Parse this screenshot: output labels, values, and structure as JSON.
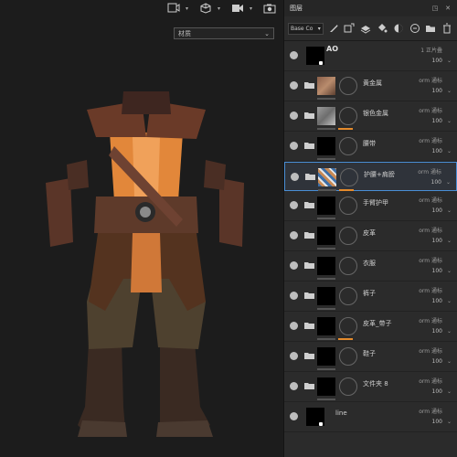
{
  "panel": {
    "title": "图层",
    "channel_select": "Base Co",
    "layers": [
      {
        "name": "AO",
        "blend": "1 正片叠",
        "opacity": "100",
        "type": "fill"
      },
      {
        "name": "黄金属",
        "blend": "orm 通标",
        "opacity": "100",
        "type": "folder",
        "thumb": "color1"
      },
      {
        "name": "银色金属",
        "blend": "orm 通标",
        "opacity": "100",
        "type": "folder",
        "thumb": "color2",
        "mask_bar": true
      },
      {
        "name": "腰带",
        "blend": "orm 通标",
        "opacity": "100",
        "type": "folder"
      },
      {
        "name": "护腰+肩膀",
        "blend": "orm 通标",
        "opacity": "100",
        "type": "folder",
        "thumb": "color3",
        "mask_bar": true,
        "selected": true
      },
      {
        "name": "手臂护甲",
        "blend": "orm 通标",
        "opacity": "100",
        "type": "folder"
      },
      {
        "name": "皮革",
        "blend": "orm 通标",
        "opacity": "100",
        "type": "folder"
      },
      {
        "name": "衣服",
        "blend": "orm 通标",
        "opacity": "100",
        "type": "folder"
      },
      {
        "name": "裤子",
        "blend": "orm 通标",
        "opacity": "100",
        "type": "folder"
      },
      {
        "name": "皮革_带子",
        "blend": "orm 通标",
        "opacity": "100",
        "type": "folder",
        "mask_bar": true
      },
      {
        "name": "鞋子",
        "blend": "orm 通标",
        "opacity": "100",
        "type": "folder"
      },
      {
        "name": "文件夹 8",
        "blend": "orm 通标",
        "opacity": "100",
        "type": "folder"
      },
      {
        "name": "line",
        "blend": "orm 通标",
        "opacity": "100",
        "type": "fill"
      }
    ]
  },
  "viewport": {
    "material_dropdown": "材质"
  },
  "colors": {
    "accent": "#4a8fd6",
    "mask_bar": "#e58b2c",
    "armor_orange": "#e2873a",
    "armor_leather": "#5a3528"
  },
  "icons": [
    "camera-icon",
    "cube-icon",
    "video-icon",
    "screenshot-icon",
    "brush-icon",
    "fill-icon",
    "mask-icon",
    "folder-icon",
    "trash-icon",
    "eye-icon"
  ]
}
